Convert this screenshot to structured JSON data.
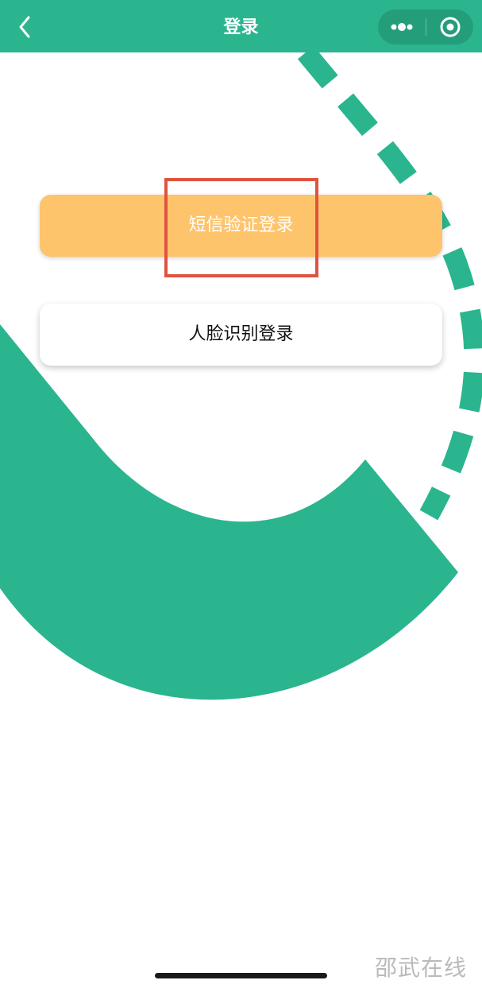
{
  "nav": {
    "title": "登录",
    "back_icon": "chevron-left-icon",
    "more_icon": "more-dots-icon",
    "close_icon": "target-circle-icon"
  },
  "buttons": {
    "sms_login": "短信验证登录",
    "face_login": "人脸识别登录"
  },
  "watermark": "邵武在线",
  "colors": {
    "brand_green": "#2ab58e",
    "sms_button": "#fdc46c",
    "highlight": "#e0533f"
  }
}
